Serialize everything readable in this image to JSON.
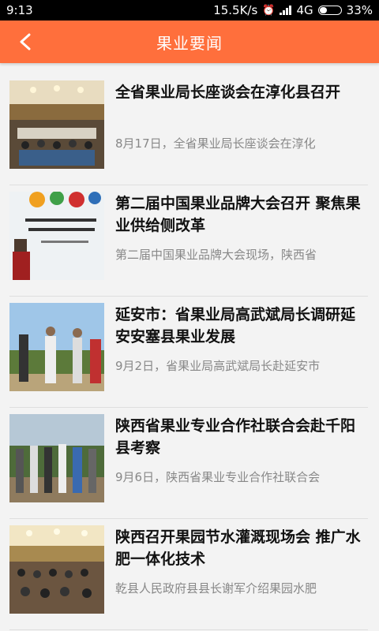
{
  "status": {
    "time": "9:13",
    "speed": "15.5K/s",
    "network": "4G",
    "battery": "33%",
    "battery_level": 0.33
  },
  "header": {
    "title": "果业要闻",
    "back_icon": "chevron-left-icon"
  },
  "colors": {
    "accent": "#ff6f3c",
    "title_text": "#111111",
    "summary_text": "#888888"
  },
  "news": [
    {
      "title": "全省果业局长座谈会在淳化县召开",
      "summary": "8月17日，全省果业局长座谈会在淳化"
    },
    {
      "title": "第二届中国果业品牌大会召开 聚焦果业供给侧改革",
      "summary": "第二届中国果业品牌大会现场，陕西省"
    },
    {
      "title": "延安市：省果业局高武斌局长调研延安安塞县果业发展",
      "summary": "9月2日，省果业局高武斌局长赴延安市"
    },
    {
      "title": "陕西省果业专业合作社联合会赴千阳县考察",
      "summary": "9月6日，陕西省果业专业合作社联合会"
    },
    {
      "title": "陕西召开果园节水灌溉现场会 推广水肥一体化技术",
      "summary": "乾县人民政府县县长谢军介绍果园水肥"
    }
  ]
}
